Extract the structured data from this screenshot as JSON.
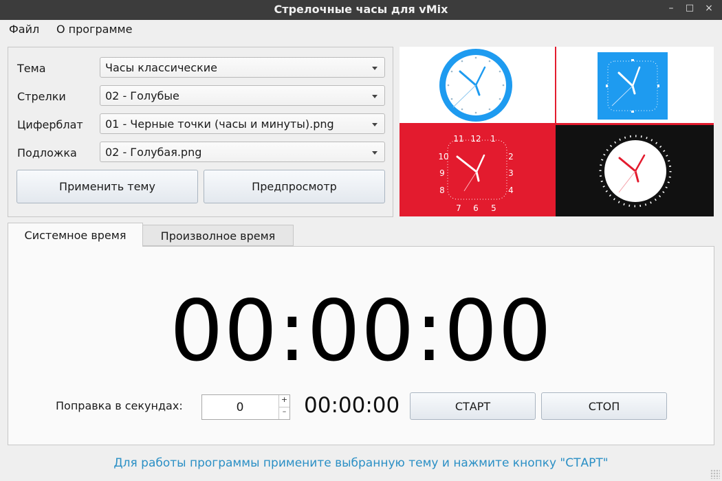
{
  "window": {
    "title": "Стрелочные часы для vMix",
    "minimize": "–",
    "maximize": "□",
    "close": "×"
  },
  "menu": {
    "file": "Файл",
    "about": "О программе"
  },
  "settings": {
    "theme_label": "Тема",
    "theme_value": "Часы классические",
    "hands_label": "Стрелки",
    "hands_value": "02 - Голубые",
    "dial_label": "Циферблат",
    "dial_value": "01 - Черные точки (часы и минуты).png",
    "backing_label": "Подложка",
    "backing_value": "02 - Голубая.png",
    "apply_button": "Применить тему",
    "preview_button": "Предпросмотр"
  },
  "preview": {
    "colors": {
      "blue": "#1e9bf0",
      "red": "#e31b2e",
      "black": "#111111",
      "white": "#ffffff"
    },
    "red_dial_numerals": [
      "12",
      "1",
      "2",
      "3",
      "4",
      "5",
      "6",
      "7",
      "8",
      "9",
      "10",
      "11"
    ]
  },
  "tabs": {
    "system": "Системное время",
    "custom": "Произволное время"
  },
  "system_panel": {
    "big_time": "00:00:00",
    "correction_label": "Поправка в секундах:",
    "correction_value": "0",
    "spin_up": "+",
    "spin_down": "–",
    "small_time": "00:00:00",
    "start_button": "СТАРТ",
    "stop_button": "СТОП"
  },
  "status": {
    "message": "Для работы программы примените выбранную тему и нажмите кнопку \"СТАРТ\""
  }
}
